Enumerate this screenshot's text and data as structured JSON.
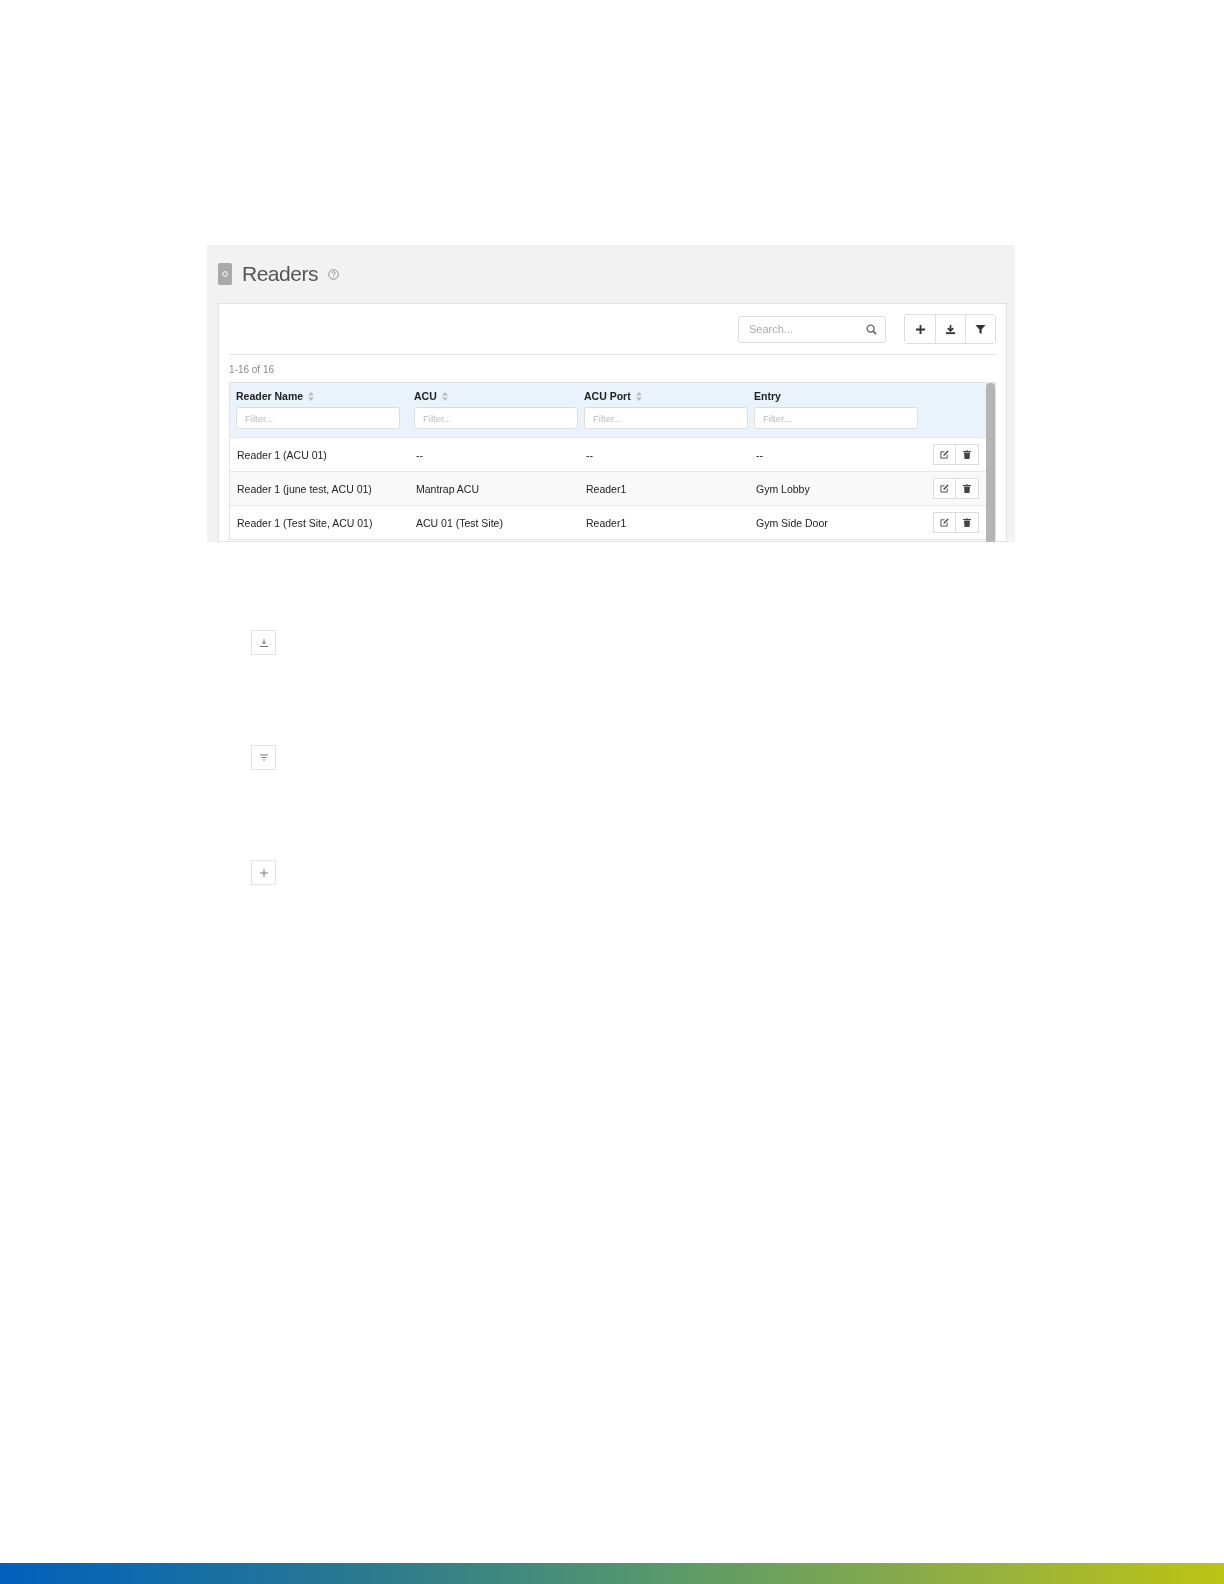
{
  "page_title": "Readers",
  "toolbar": {
    "search": {
      "placeholder": "Search..."
    },
    "buttons": [
      {
        "kind": "add"
      },
      {
        "kind": "download"
      },
      {
        "kind": "filter"
      }
    ]
  },
  "result_count": "1-16 of 16",
  "columns": [
    {
      "label": "Reader Name",
      "sortable": true,
      "filter_placeholder": "Filter..."
    },
    {
      "label": "ACU",
      "sortable": true,
      "filter_placeholder": "Filter..."
    },
    {
      "label": "ACU Port",
      "sortable": true,
      "filter_placeholder": "Filter..."
    },
    {
      "label": "Entry",
      "sortable": false,
      "filter_placeholder": "Filter..."
    }
  ],
  "rows": [
    {
      "cells": [
        "Reader 1 (ACU 01)",
        "--",
        "--",
        "--"
      ]
    },
    {
      "cells": [
        "Reader 1 (june test, ACU 01)",
        "Mantrap ACU",
        "Reader1",
        "Gym Lobby"
      ]
    },
    {
      "cells": [
        "Reader 1 (Test Site, ACU 01)",
        "ACU 01 (Test Site)",
        "Reader1",
        "Gym Side Door"
      ]
    }
  ],
  "standalone_buttons": [
    {
      "kind": "download"
    },
    {
      "kind": "filter"
    },
    {
      "kind": "add"
    }
  ]
}
